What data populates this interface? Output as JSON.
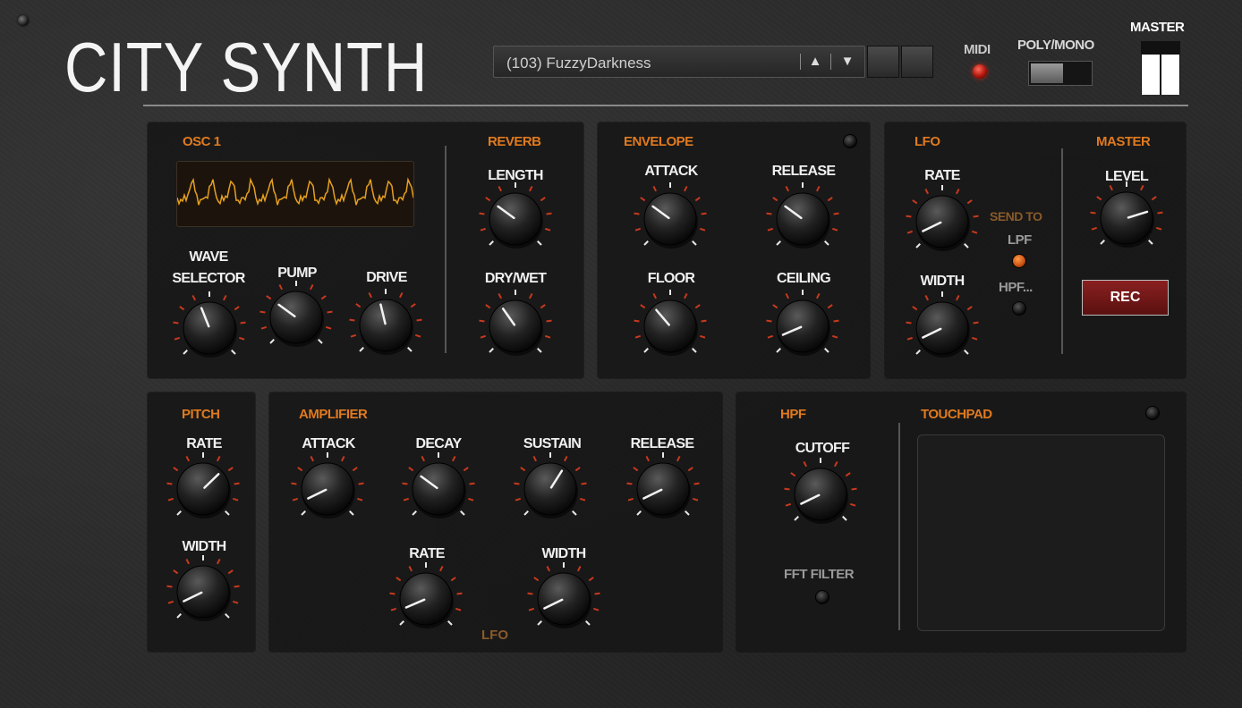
{
  "app": {
    "title": "CITY SYNTH"
  },
  "preset": {
    "name": "(103) FuzzyDarkness",
    "up_icon": "▲",
    "down_icon": "▼"
  },
  "header": {
    "midi_label": "MIDI",
    "polymono_label": "POLY/MONO",
    "master_label": "MASTER"
  },
  "master_meter": {
    "left_level": 0.75,
    "right_level": 0.75
  },
  "osc1": {
    "title": "OSC 1",
    "wave_selector": "WAVE\nSELECTOR",
    "pump": "PUMP",
    "drive": "DRIVE"
  },
  "reverb": {
    "title": "REVERB",
    "length": "LENGTH",
    "drywet": "DRY/WET"
  },
  "envelope": {
    "title": "ENVELOPE",
    "attack": "ATTACK",
    "release": "RELEASE",
    "floor": "FLOOR",
    "ceiling": "CEILING"
  },
  "lfo": {
    "title": "LFO",
    "rate": "RATE",
    "width": "WIDTH",
    "send_to": "SEND TO",
    "lpf": "LPF",
    "hpf": "HPF..."
  },
  "master": {
    "title": "MASTER",
    "level": "LEVEL",
    "rec": "REC"
  },
  "pitch": {
    "title": "PITCH",
    "rate": "RATE",
    "width": "WIDTH"
  },
  "amplifier": {
    "title": "AMPLIFIER",
    "attack": "ATTACK",
    "decay": "DECAY",
    "sustain": "SUSTAIN",
    "release": "RELEASE",
    "rate": "RATE",
    "width": "WIDTH",
    "lfo_tag": "LFO"
  },
  "hpf": {
    "title": "HPF",
    "cutoff": "CUTOFF",
    "fft_filter": "FFT FILTER"
  },
  "touchpad": {
    "title": "TOUCHPAD"
  },
  "knob_values": {
    "wave_selector": 0.42,
    "pump": 0.3,
    "drive": 0.45,
    "reverb_length": 0.3,
    "reverb_drywet": 0.37,
    "env_attack": 0.3,
    "env_release": 0.3,
    "env_floor": 0.35,
    "env_ceiling": 0.08,
    "lfo_rate": 0.07,
    "lfo_width": 0.07,
    "master_level": 0.77,
    "pitch_rate": 0.67,
    "pitch_width": 0.07,
    "amp_attack": 0.07,
    "amp_decay": 0.3,
    "amp_sustain": 0.62,
    "amp_release": 0.07,
    "amp_lfo_rate": 0.08,
    "amp_lfo_width": 0.07,
    "hpf_cutoff": 0.07
  },
  "colors": {
    "accent": "#e07a1f",
    "tick": "#c8391e",
    "panel": "#181818",
    "rec": "#7a1818"
  }
}
